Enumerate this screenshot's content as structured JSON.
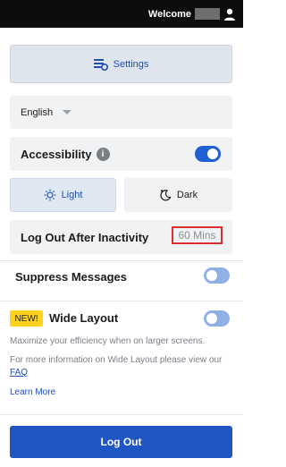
{
  "header": {
    "welcome_text": "Welcome",
    "user_icon": "user-icon"
  },
  "settings": {
    "button_label": "Settings",
    "icon": "settings-sliders-icon"
  },
  "language": {
    "selected": "English"
  },
  "accessibility": {
    "label": "Accessibility",
    "info_glyph": "i",
    "enabled": true
  },
  "theme": {
    "light_label": "Light",
    "dark_label": "Dark",
    "selected": "Light"
  },
  "logout_inactivity": {
    "label": "Log Out After Inactivity",
    "value": "60 Mins"
  },
  "suppress_messages": {
    "label": "Suppress Messages",
    "enabled": false
  },
  "wide_layout": {
    "badge": "NEW!",
    "label": "Wide Layout",
    "enabled": false,
    "description": "Maximize your efficiency when on larger screens.",
    "faq_text_prefix": "For more information on Wide Layout please view our",
    "faq_link": "FAQ",
    "learn_more": "Learn More"
  },
  "footer": {
    "logout_label": "Log Out"
  },
  "colors": {
    "accent": "#1f56c4",
    "toggle_on": "#1f60d4",
    "toggle_off": "#8fb1e6",
    "highlight_border": "#d93030",
    "badge": "#ffd21f"
  }
}
